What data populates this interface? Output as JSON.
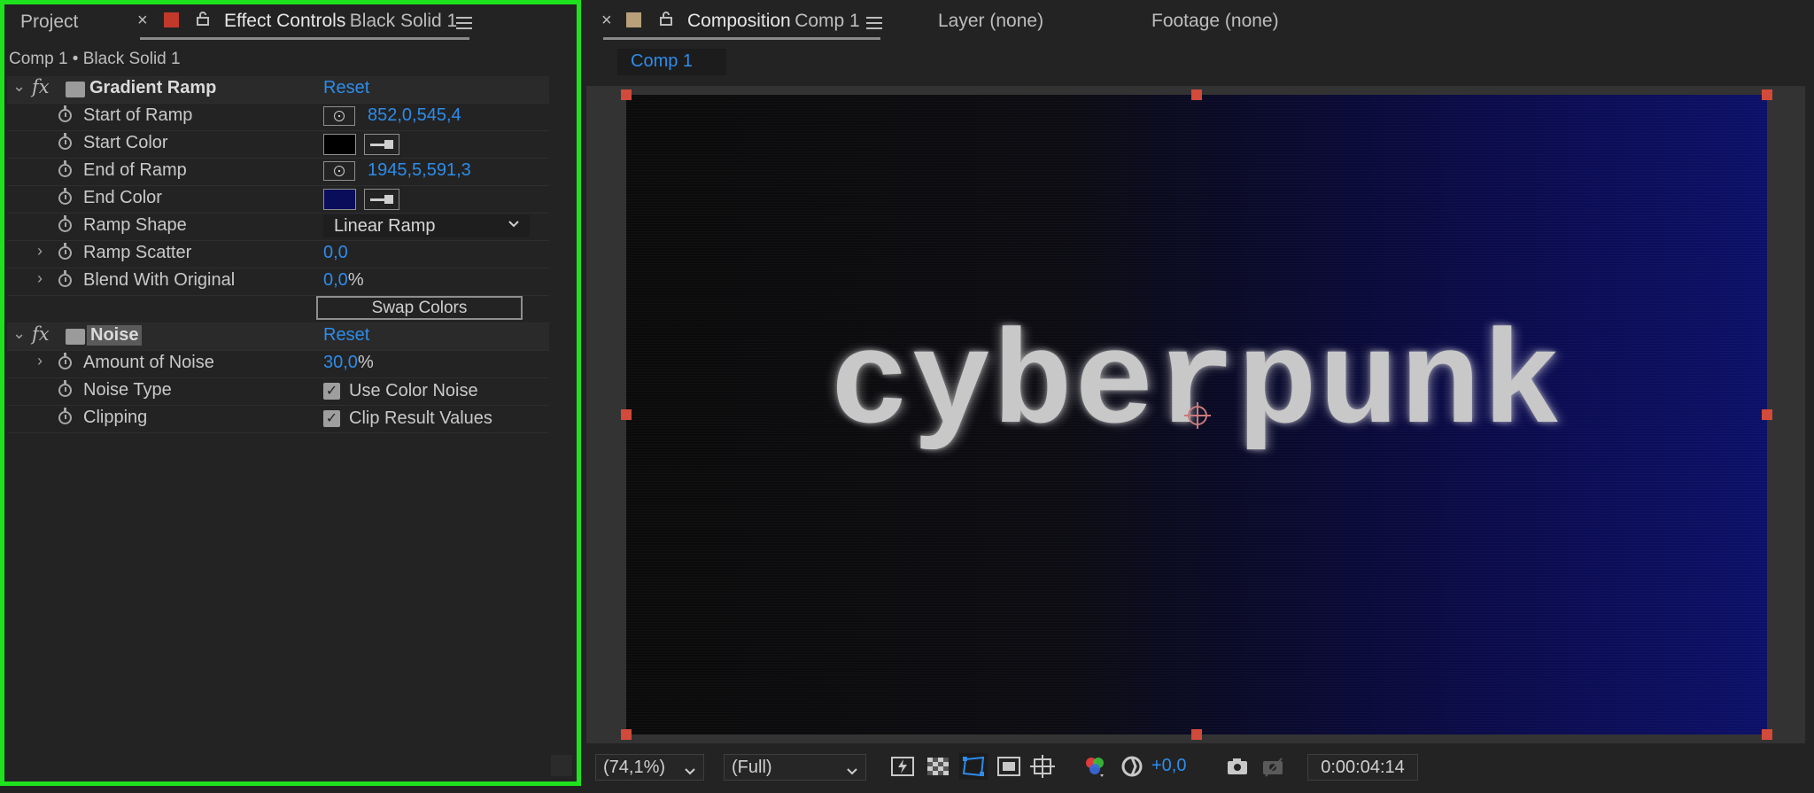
{
  "left": {
    "project_tab": "Project",
    "close_glyph": "×",
    "effect_controls_label": "Effect Controls",
    "effect_controls_layer": "Black Solid 1",
    "breadcrumb": "Comp 1 • Black Solid 1",
    "gradient_ramp": {
      "fx": "fx",
      "name": "Gradient Ramp",
      "reset": "Reset",
      "start_of_ramp_label": "Start of Ramp",
      "start_of_ramp_value": "852,0,545,4",
      "start_color_label": "Start Color",
      "start_color": "#000000",
      "end_of_ramp_label": "End of Ramp",
      "end_of_ramp_value": "1945,5,591,3",
      "end_color_label": "End Color",
      "end_color": "#0a0d5a",
      "ramp_shape_label": "Ramp Shape",
      "ramp_shape_value": "Linear Ramp",
      "ramp_scatter_label": "Ramp Scatter",
      "ramp_scatter_value": "0,0",
      "blend_label": "Blend With Original",
      "blend_value": "0,0",
      "blend_unit": "%",
      "swap_colors": "Swap Colors"
    },
    "noise": {
      "fx": "fx",
      "name": "Noise",
      "reset": "Reset",
      "amount_label": "Amount of Noise",
      "amount_value": "30,0",
      "amount_unit": "%",
      "noise_type_label": "Noise Type",
      "use_color_noise": "Use Color Noise",
      "clipping_label": "Clipping",
      "clip_result": "Clip Result Values"
    }
  },
  "right": {
    "close_glyph": "×",
    "composition_label": "Composition",
    "composition_name": "Comp 1",
    "layer_tab": "Layer (none)",
    "footage_tab": "Footage (none)",
    "comp_chip": "Comp 1",
    "comp_text": "cyberpunk",
    "zoom": "(74,1%)",
    "resolution": "(Full)",
    "exposure": "+0,0",
    "timecode": "0:00:04:14"
  },
  "colors": {
    "accent": "#2d8ceb",
    "highlight_border": "#1ee21e",
    "label_red": "#c0392b",
    "label_tan": "#b8a07a"
  }
}
